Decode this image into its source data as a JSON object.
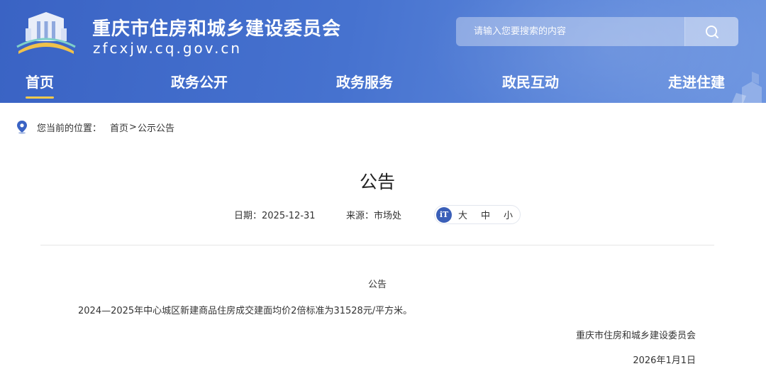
{
  "header": {
    "site_title": "重庆市住房和城乡建设委员会",
    "site_domain": "zfcxjw.cq.gov.cn",
    "search": {
      "placeholder": "请输入您要搜索的内容"
    }
  },
  "nav": {
    "items": [
      {
        "label": "首页",
        "active": true
      },
      {
        "label": "政务公开",
        "active": false
      },
      {
        "label": "政务服务",
        "active": false
      },
      {
        "label": "政民互动",
        "active": false
      },
      {
        "label": "走进住建",
        "active": false
      }
    ]
  },
  "breadcrumb": {
    "label": "您当前的位置：",
    "home": "首页",
    "separator": ">",
    "current": "公示公告"
  },
  "article": {
    "title": "公告",
    "date_label": "日期：",
    "date": "2025-12-31",
    "source_label": "来源：",
    "source": "市场处",
    "font_size": {
      "badge": "iT",
      "large": "大",
      "medium": "中",
      "small": "小"
    },
    "body_heading": "公告",
    "body_text": "2024—2025年中心城区新建商品住房成交建面均价2倍标准为31528元/平方米。",
    "signature_org": "重庆市住房和城乡建设委员会",
    "signature_date": "2026年1月1日"
  },
  "colors": {
    "header_primary": "#3a63c4",
    "header_light": "#6d95e0",
    "nav_active_underline": "#f2c94c",
    "font_badge": "#3a5fb8"
  }
}
